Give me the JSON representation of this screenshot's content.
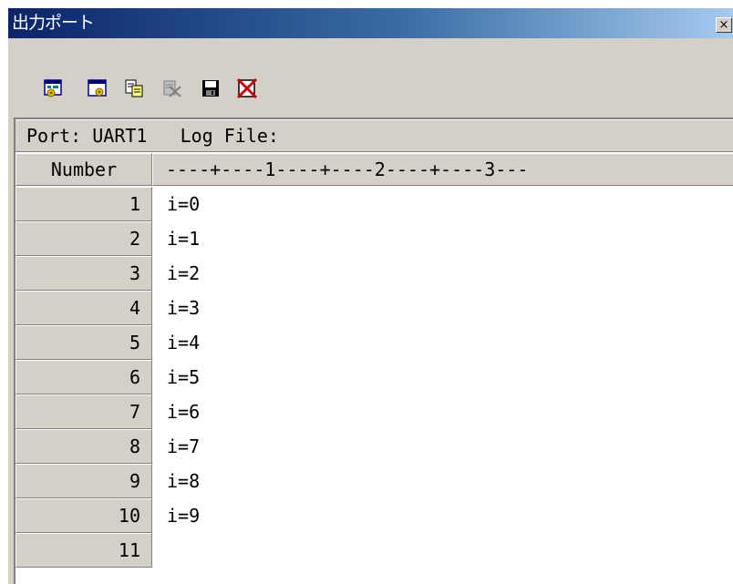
{
  "window": {
    "title": "出力ポート",
    "close_label": "×"
  },
  "toolbar": {
    "buttons": [
      {
        "icon": "settings-window-icon"
      },
      {
        "icon": "window-settings-icon"
      },
      {
        "icon": "copy-icon"
      },
      {
        "icon": "clear-icon"
      },
      {
        "icon": "save-icon"
      },
      {
        "icon": "delete-icon"
      }
    ]
  },
  "info": {
    "text": "Port: UART1   Log File:"
  },
  "table": {
    "number_header": "Number",
    "ruler": "----+----1----+----2----+----3---",
    "rows": [
      {
        "num": "1",
        "text": "i=0"
      },
      {
        "num": "2",
        "text": "i=1"
      },
      {
        "num": "3",
        "text": "i=2"
      },
      {
        "num": "4",
        "text": "i=3"
      },
      {
        "num": "5",
        "text": "i=4"
      },
      {
        "num": "6",
        "text": "i=5"
      },
      {
        "num": "7",
        "text": "i=6"
      },
      {
        "num": "8",
        "text": "i=7"
      },
      {
        "num": "9",
        "text": "i=8"
      },
      {
        "num": "10",
        "text": "i=9"
      },
      {
        "num": "11",
        "text": ""
      }
    ]
  }
}
